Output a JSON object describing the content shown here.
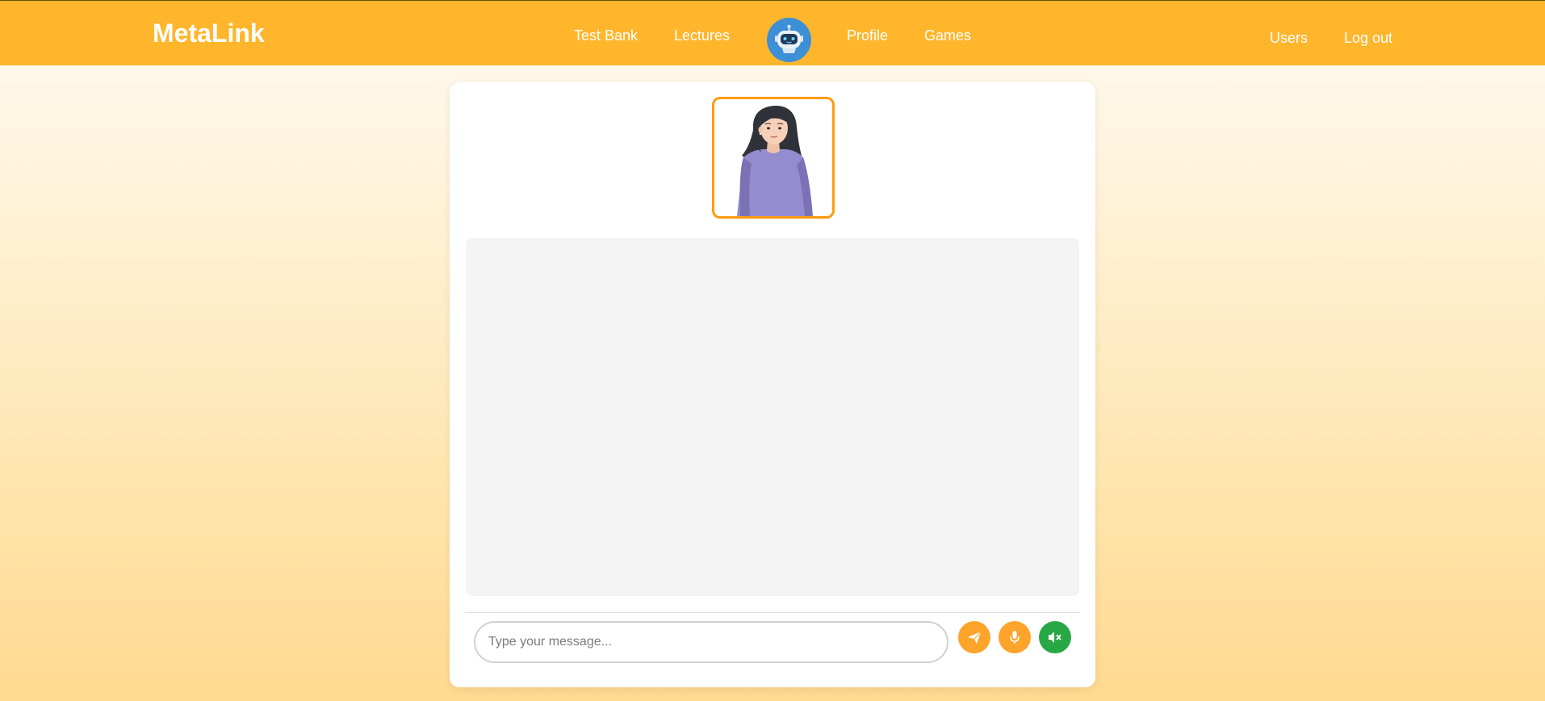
{
  "nav": {
    "brand": "MetaLink",
    "links": {
      "test_bank": "Test Bank",
      "lectures": "Lectures",
      "profile": "Profile",
      "games": "Games",
      "users": "Users",
      "logout": "Log out"
    },
    "bar_color": "#ffb62c",
    "bot_icon": "robot-icon"
  },
  "chat": {
    "avatar_icon": "woman-avatar",
    "input_placeholder": "Type your message...",
    "buttons": {
      "send": {
        "icon": "send-icon",
        "color": "#ffa42b"
      },
      "mic": {
        "icon": "microphone-icon",
        "color": "#ffa42b"
      },
      "mute": {
        "icon": "speaker-mute-icon",
        "color": "#28a745"
      }
    },
    "avatar_border_color": "#ff9b0f"
  }
}
